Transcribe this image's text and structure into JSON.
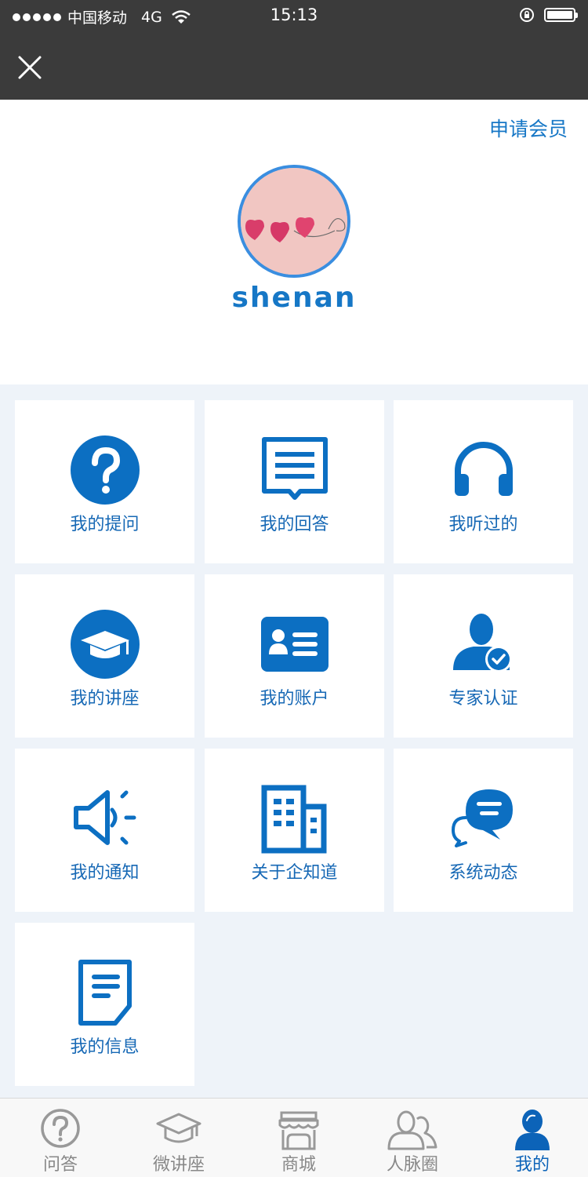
{
  "status_bar": {
    "carrier": "中国移动",
    "network": "4G",
    "time": "15:13"
  },
  "header": {
    "close_icon": "close-icon"
  },
  "profile": {
    "apply_member": "申请会员",
    "username": "shenan"
  },
  "menu": [
    {
      "label": "我的提问",
      "icon": "question-icon"
    },
    {
      "label": "我的回答",
      "icon": "answer-icon"
    },
    {
      "label": "我听过的",
      "icon": "headphones-icon"
    },
    {
      "label": "我的讲座",
      "icon": "graduation-cap-icon"
    },
    {
      "label": "我的账户",
      "icon": "id-card-icon"
    },
    {
      "label": "专家认证",
      "icon": "expert-verified-icon"
    },
    {
      "label": "我的通知",
      "icon": "speaker-icon"
    },
    {
      "label": "关于企知道",
      "icon": "building-icon"
    },
    {
      "label": "系统动态",
      "icon": "chat-bubbles-icon"
    },
    {
      "label": "我的信息",
      "icon": "document-icon"
    }
  ],
  "tabbar": [
    {
      "label": "问答",
      "icon": "question-circle-icon",
      "active": false
    },
    {
      "label": "微讲座",
      "icon": "graduation-cap-icon",
      "active": false
    },
    {
      "label": "商城",
      "icon": "store-icon",
      "active": false
    },
    {
      "label": "人脉圈",
      "icon": "people-icon",
      "active": false
    },
    {
      "label": "我的",
      "icon": "user-icon",
      "active": true
    }
  ],
  "colors": {
    "accent": "#1677c6",
    "icon_blue": "#0c6fc2",
    "header_bg": "#3b3b3b",
    "page_bg": "#eef3f9",
    "tab_inactive": "#888888"
  }
}
